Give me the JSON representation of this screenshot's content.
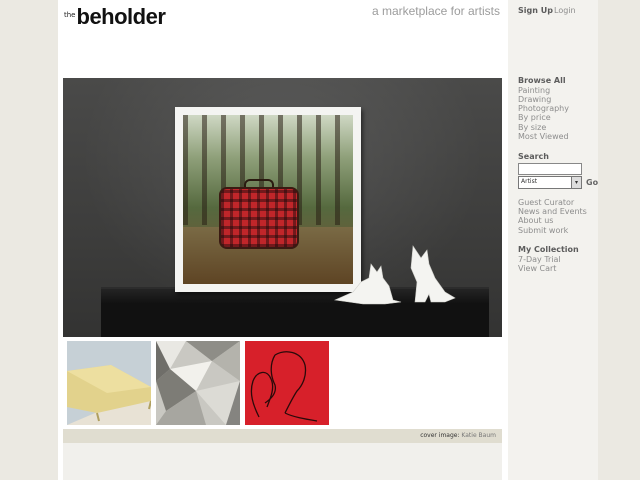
{
  "header": {
    "logo_the": "the",
    "logo_main": "beholder",
    "tagline": "a marketplace for artists"
  },
  "account": {
    "signup": "Sign Up",
    "login": "Login"
  },
  "browse": {
    "heading": "Browse All",
    "items": [
      "Painting",
      "Drawing",
      "Photography",
      "By price",
      "By size",
      "Most Viewed"
    ]
  },
  "search": {
    "heading": "Search",
    "query": "",
    "category": "Artist",
    "go_label": "Go"
  },
  "info_links": [
    "Guest Curator",
    "News and Events",
    "About us",
    "Submit work"
  ],
  "collection": {
    "heading": "My Collection",
    "items": [
      "7-Day Trial",
      "View Cart"
    ]
  },
  "caption": {
    "label": "cover image:",
    "artist": "Katie Baum"
  },
  "colors": {
    "page_bg": "#eceae3",
    "sidebar_bg": "#f3f2ee",
    "caption_bar": "#e0ddd0",
    "accent_red": "#d7202a"
  }
}
